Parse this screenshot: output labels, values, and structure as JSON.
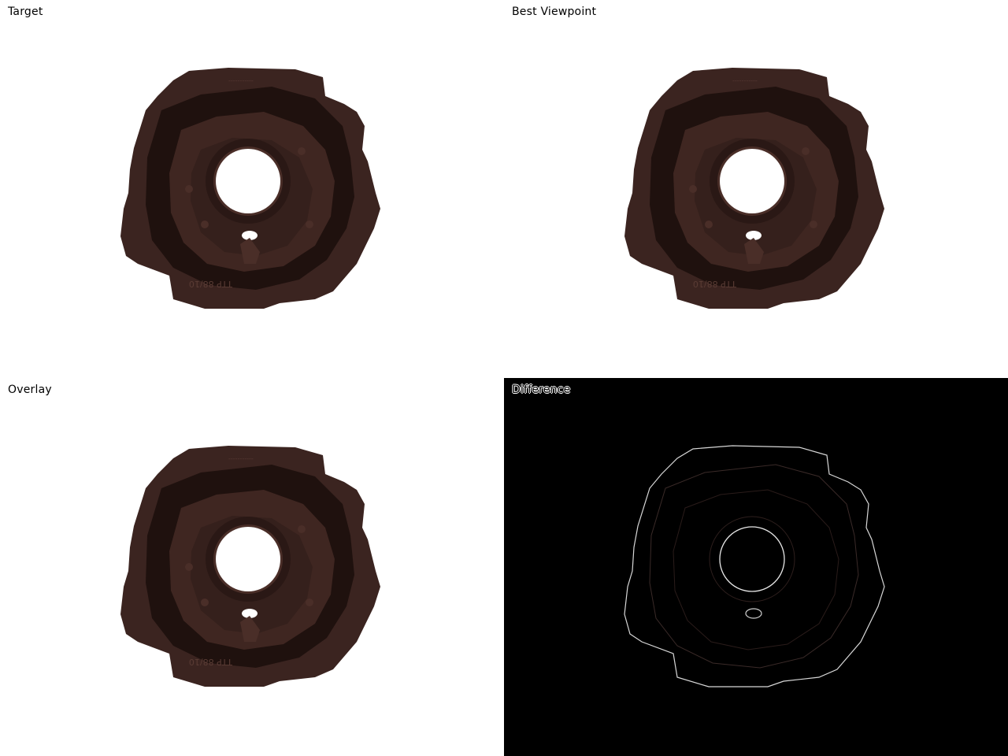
{
  "panels": {
    "target": {
      "label": "Target"
    },
    "best": {
      "label": "Best Viewpoint"
    },
    "overlay": {
      "label": "Overlay"
    },
    "difference": {
      "label": "Difference"
    }
  },
  "colors": {
    "part_body": "#3b2420",
    "part_dark": "#1f110e",
    "part_light": "#4a2e28",
    "background_light": "#ffffff",
    "background_dark": "#000000",
    "edge_diff": "#d8d8d8"
  }
}
